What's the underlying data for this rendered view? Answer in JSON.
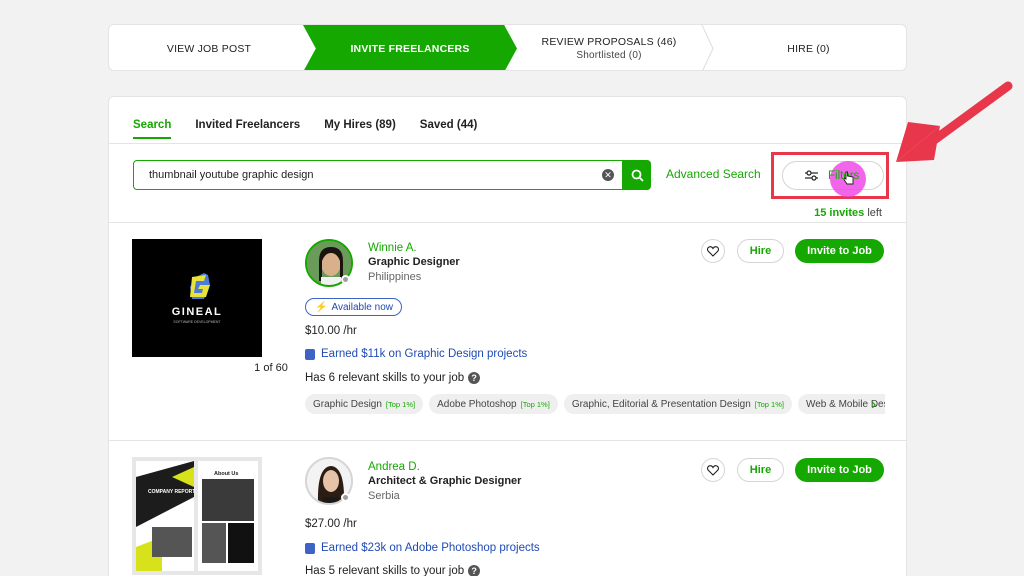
{
  "stepper": {
    "steps": [
      {
        "label": "VIEW JOB POST"
      },
      {
        "label": "INVITE FREELANCERS"
      },
      {
        "label": "REVIEW PROPOSALS (46)",
        "sub": "Shortlisted (0)"
      },
      {
        "label": "HIRE (0)"
      }
    ]
  },
  "tabs": [
    "Search",
    "Invited Freelancers",
    "My Hires (89)",
    "Saved (44)"
  ],
  "search": {
    "value": "thumbnail youtube graphic design"
  },
  "advanced_search": "Advanced Search",
  "filters_label": "Filters",
  "invites": {
    "count": "15 invites",
    "suffix": "left"
  },
  "freelancers": [
    {
      "name": "Winnie A.",
      "title": "Graphic Designer",
      "country": "Philippines",
      "available": "Available now",
      "rate": "$10.00 /hr",
      "earned": "Earned $11k on Graphic Design projects",
      "skills_text": "Has 6 relevant skills to your job",
      "portfolio_caption": "1 of 60",
      "portfolio_logo": "GINEAL",
      "portfolio_sub": "SOFTWARE DEVELOPMENT",
      "chips": [
        {
          "label": "Graphic Design",
          "tag": "[Top 1%]"
        },
        {
          "label": "Adobe Photoshop",
          "tag": "[Top 1%]"
        },
        {
          "label": "Graphic, Editorial & Presentation Design",
          "tag": "[Top 1%]"
        },
        {
          "label": "Web & Mobile Design",
          "tag": ""
        }
      ],
      "hire": "Hire",
      "invite": "Invite to Job"
    },
    {
      "name": "Andrea D.",
      "title": "Architect & Graphic Designer",
      "country": "Serbia",
      "rate": "$27.00 /hr",
      "earned": "Earned $23k on Adobe Photoshop projects",
      "skills_text": "Has 5 relevant skills to your job",
      "portfolio_title_1": "COMPANY REPORT",
      "portfolio_title_2": "About Us",
      "hire": "Hire",
      "invite": "Invite to Job"
    }
  ],
  "colors": {
    "accent": "#14a800",
    "highlight": "#e8364b",
    "link": "#1f4bb3"
  }
}
